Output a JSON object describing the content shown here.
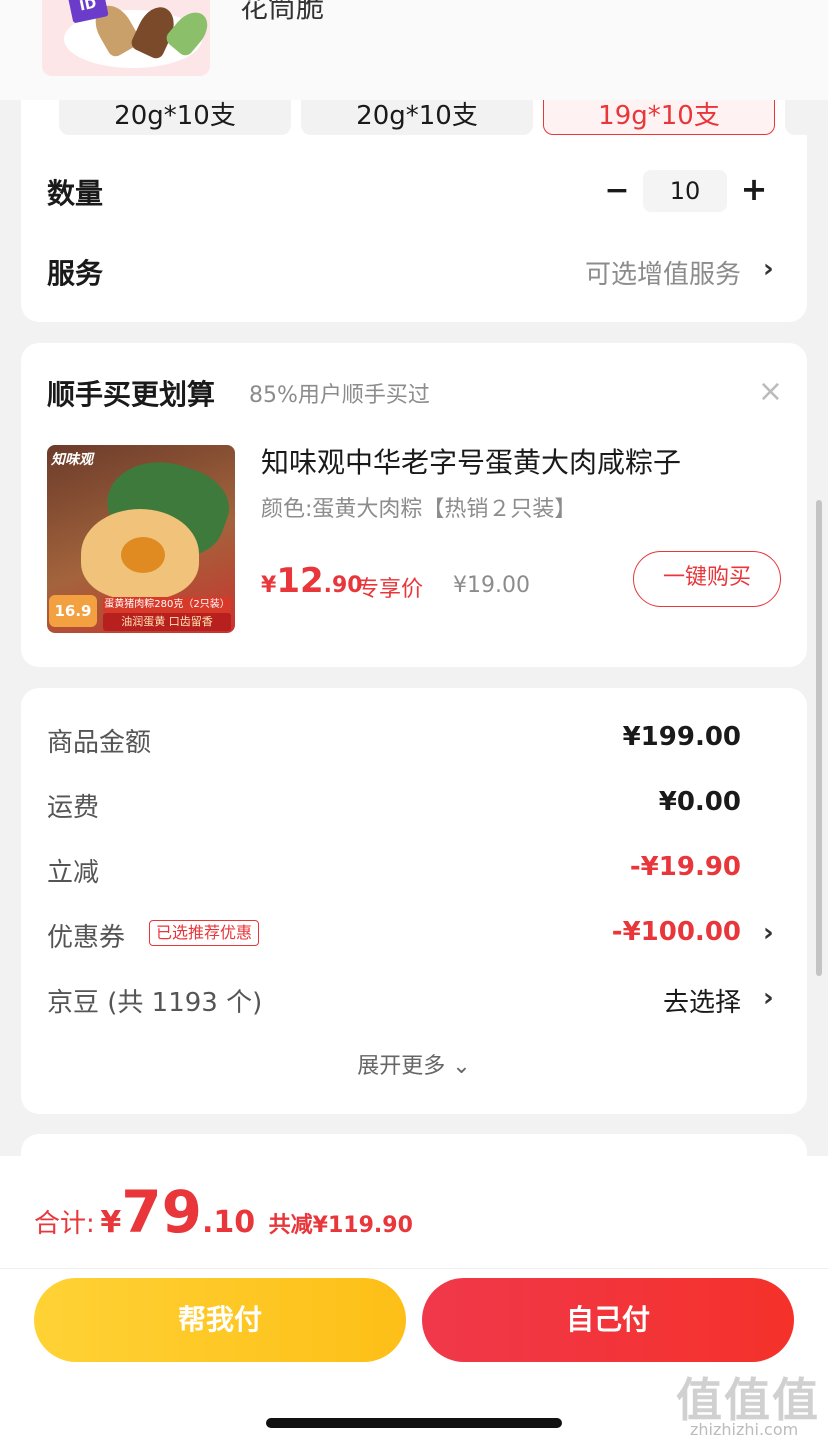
{
  "top": {
    "title_fragment": "花筒脆"
  },
  "spec": {
    "chips": [
      {
        "label": "20g*10支",
        "selected": false
      },
      {
        "label": "20g*10支",
        "selected": false
      },
      {
        "label": "19g*10支",
        "selected": true
      }
    ]
  },
  "quantity": {
    "label": "数量",
    "value": "10",
    "minus": "−",
    "plus": "+"
  },
  "service": {
    "label": "服务",
    "value": "可选增值服务",
    "chevron": "›"
  },
  "upsell": {
    "title": "顺手买更划算",
    "subtitle": "85%用户顺手买过",
    "close": "×",
    "product": {
      "name": "知味观中华老字号蛋黄大肉咸粽子",
      "spec": "颜色:蛋黄大肉粽【热销２只装】",
      "price_currency": "¥",
      "price_int": "12",
      "price_dec": ".90",
      "price_tag": "专享价",
      "original_price": "¥19.00",
      "buy_label": "一键购买",
      "image": {
        "brand": "知味观",
        "badge": "16.9",
        "banner1": "蛋黄猪肉粽280克（2只装）",
        "banner2": "油润蛋黄 口齿留香"
      }
    }
  },
  "summary": {
    "rows": [
      {
        "label": "商品金额",
        "value": "¥199.00"
      },
      {
        "label": "运费",
        "value": "¥0.00"
      },
      {
        "label": "立减",
        "value": "-¥19.90"
      },
      {
        "label": "优惠券",
        "value": "-¥100.00",
        "tag": "已选推荐优惠"
      },
      {
        "label": "京豆 (共 1193 个)",
        "value": "去选择"
      }
    ],
    "expand": "展开更多 ⌄"
  },
  "footer": {
    "total_label": "合计:",
    "total_currency": "¥",
    "total_int": "79",
    "total_dec": ".10",
    "saved": "共减¥119.90",
    "help_pay": "帮我付",
    "self_pay": "自己付"
  },
  "watermark": {
    "logo": "值值值",
    "url": "zhizhizhi.com"
  },
  "colors": {
    "accent": "#e8363a",
    "yellow": "#fdc51f",
    "muted": "#8c8c8c"
  }
}
